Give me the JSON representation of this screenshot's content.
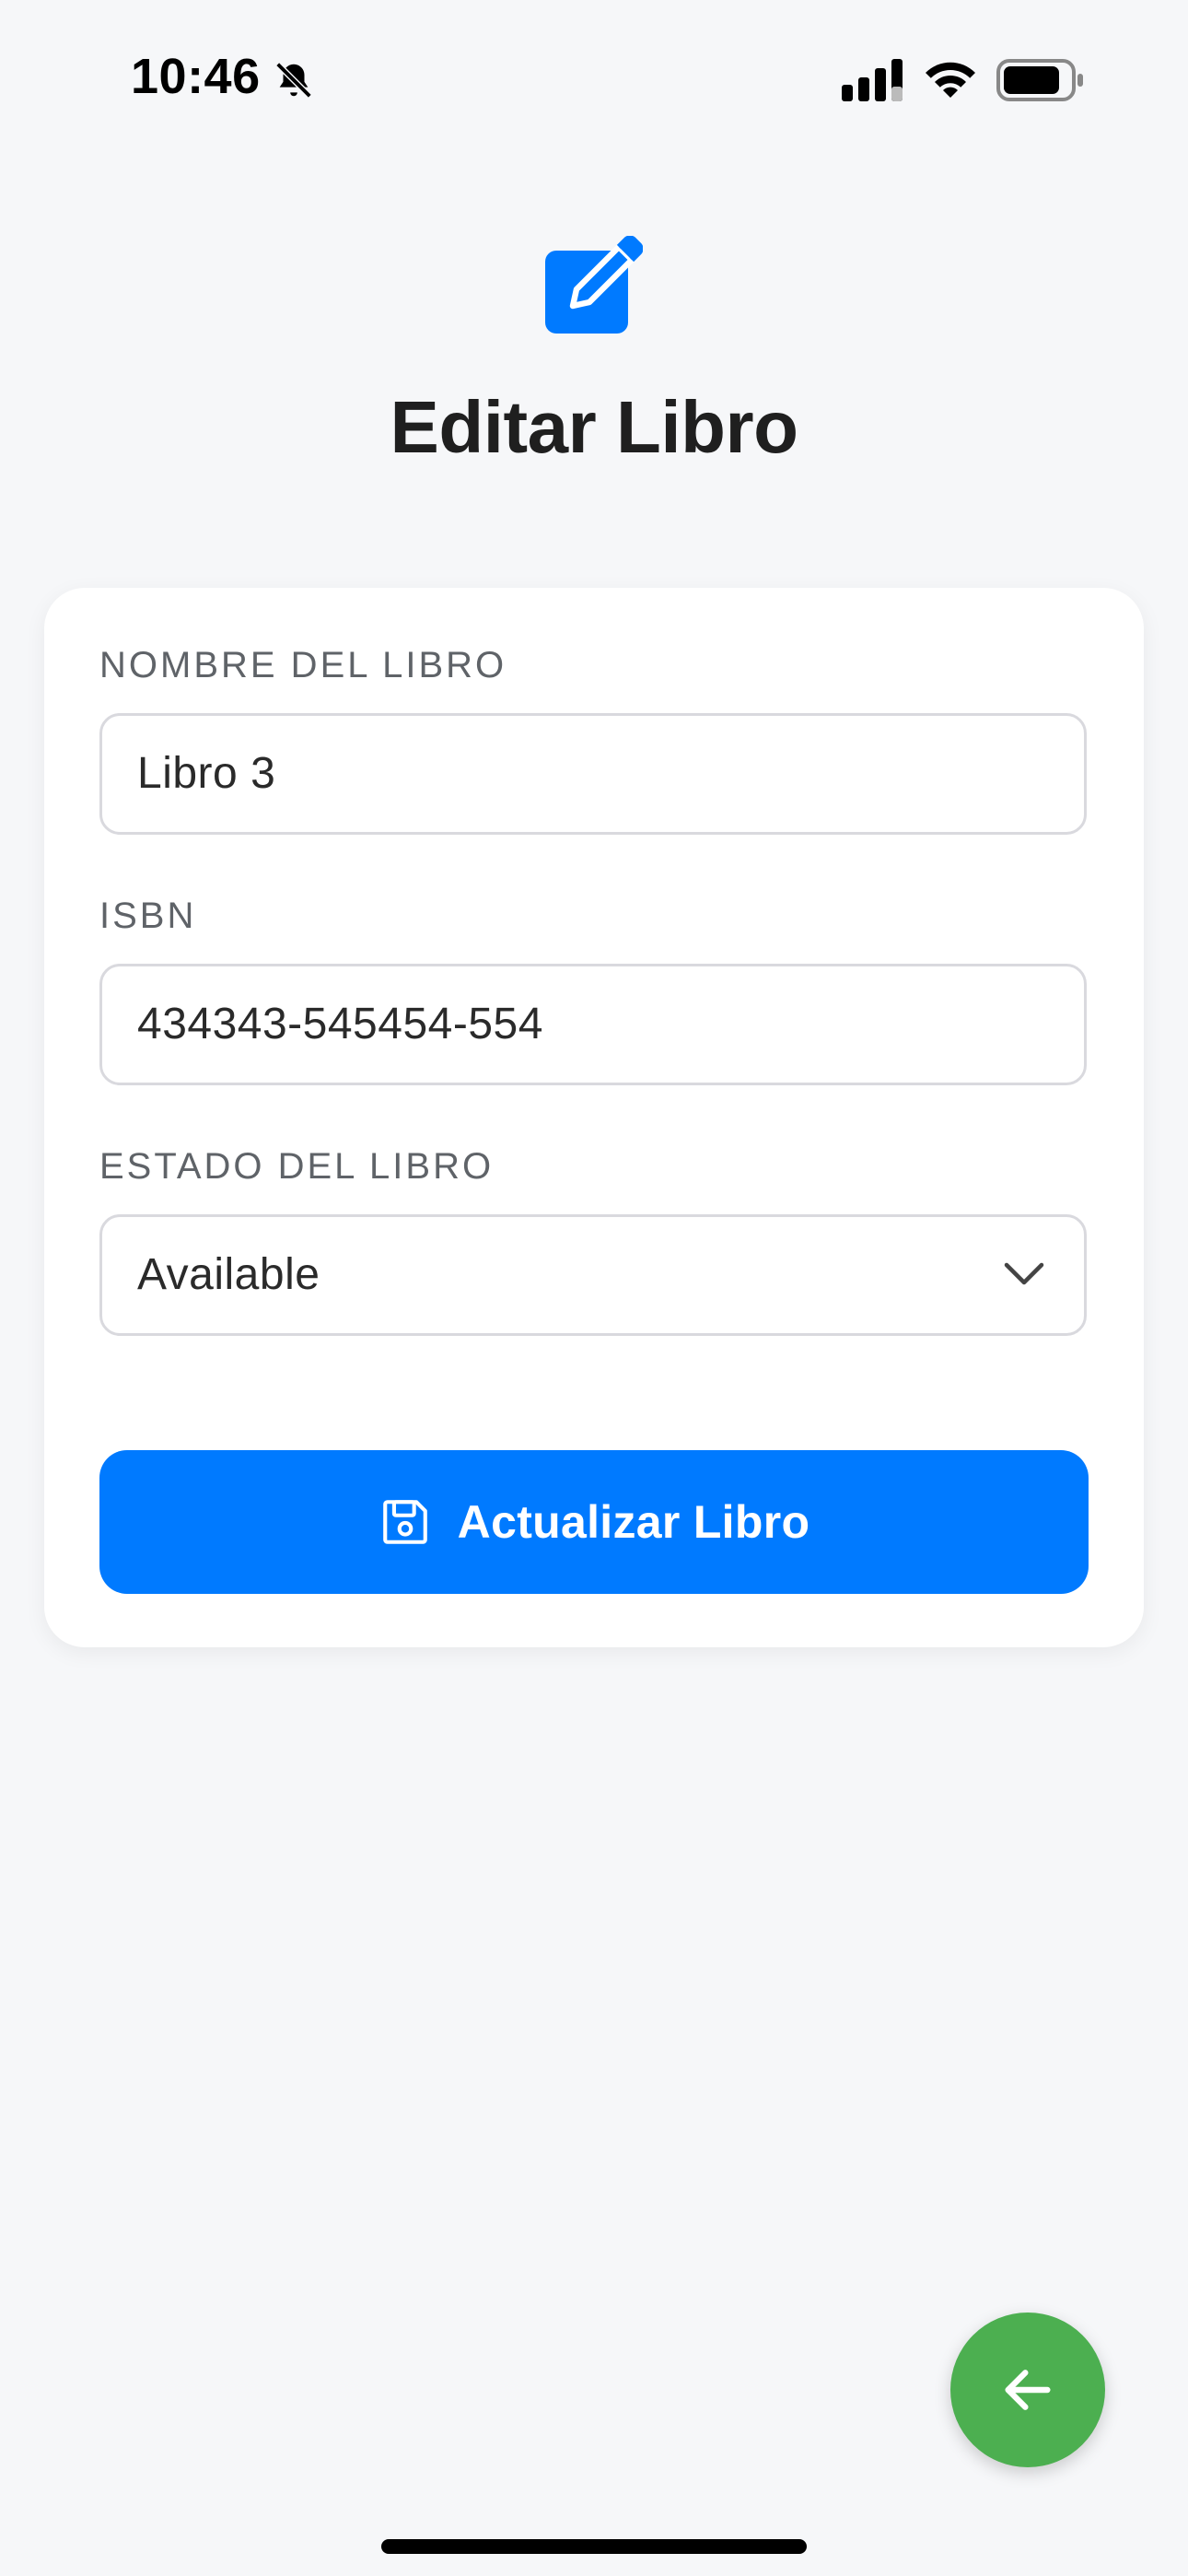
{
  "status_bar": {
    "time": "10:46",
    "icons": [
      "silent-bell-icon",
      "cellular-signal-icon",
      "wifi-icon",
      "battery-icon"
    ]
  },
  "header": {
    "icon": "edit-pencil-icon",
    "title": "Editar Libro"
  },
  "form": {
    "fields": [
      {
        "label": "NOMBRE DEL LIBRO",
        "value": "Libro 3"
      },
      {
        "label": "ISBN",
        "value": "434343-545454-554"
      },
      {
        "label": "ESTADO DEL LIBRO",
        "value": "Available"
      }
    ],
    "submit": {
      "icon": "save-floppy-icon",
      "label": "Actualizar Libro"
    }
  },
  "fab": {
    "icon": "arrow-left-icon"
  },
  "colors": {
    "primary": "#007aff",
    "fab": "#4caf50",
    "background": "#f6f7f9",
    "card": "#ffffff"
  }
}
